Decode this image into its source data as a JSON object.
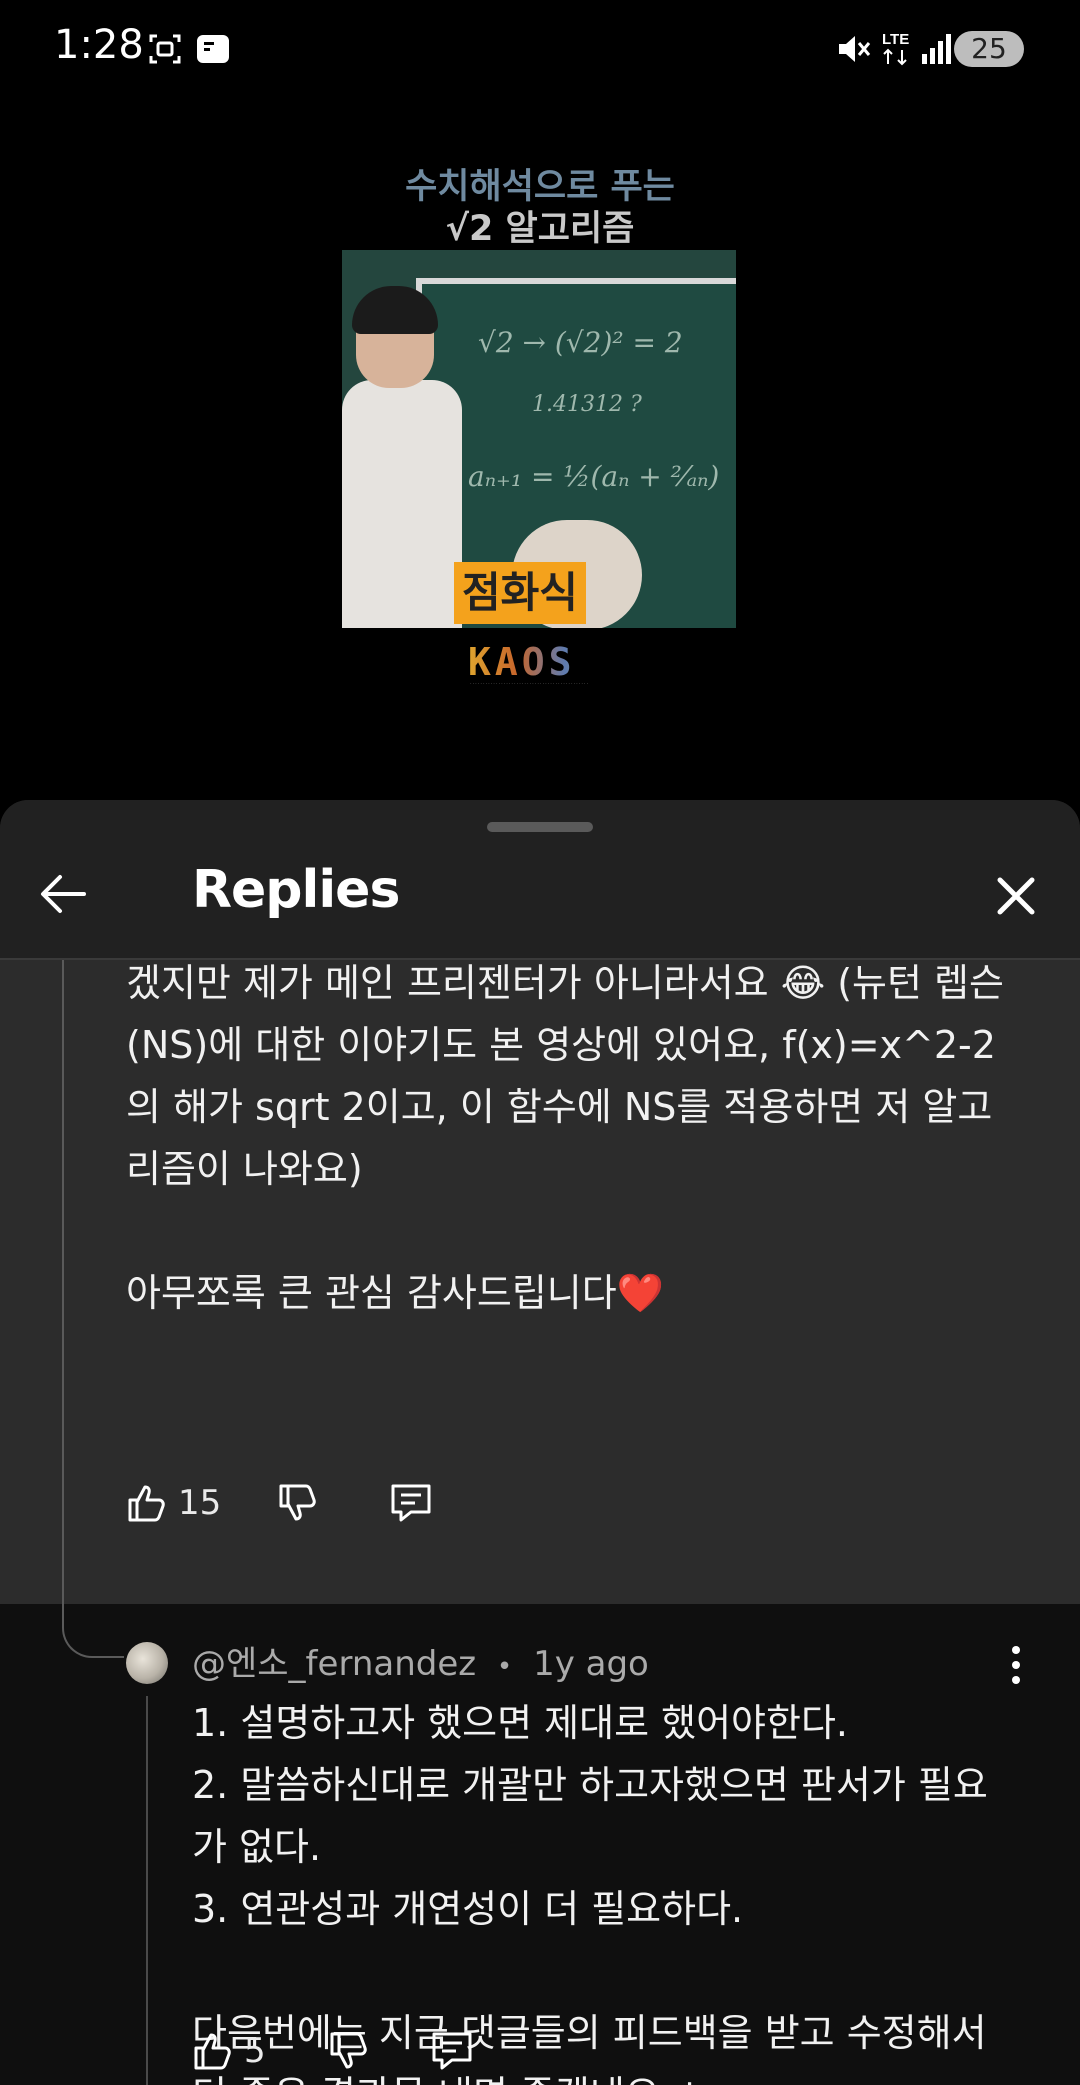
{
  "status_bar": {
    "time": "1:28",
    "network": "LTE",
    "battery": "25",
    "icons": [
      "screenshot-icon",
      "notification-icon",
      "mute-icon",
      "lte-icon",
      "signal-icon"
    ]
  },
  "video": {
    "title_line1": "수치해석으로 푸는",
    "title_line2": "√2 알고리즘",
    "subtitle": "점화식",
    "logo_text": "KAOS",
    "board_lines": [
      "√2 → (√2)² = 2",
      "1.41312 ?",
      "aₙ₊₁ = ½(aₙ + ²⁄ₐₙ)"
    ]
  },
  "sheet": {
    "title": "Replies"
  },
  "replies": [
    {
      "text": "겠지만 제가 메인 프리젠터가 아니라서요 😂 (뉴턴 렙슨(NS)에 대한 이야기도 본 영상에 있어요, f(x)=x^2-2 의 해가 sqrt 2이고, 이 함수에 NS를 적용하면 저 알고리즘이 나와요)\n\n아무쪼록 큰 관심 감사드립니다❤️",
      "likes": "15"
    },
    {
      "author": "@엔소_fernandez",
      "separator": "•",
      "time": "1y ago",
      "text": "1. 설명하고자 했으면 제대로 했어야한다.\n2. 말씀하신대로 개괄만 하고자했으면 판서가 필요가 없다.\n3. 연관성과 개연성이 더 필요하다.\n\n다음번에는 지금 댓글들의 피드백을 받고 수정해서 더 좋은 결과물 내면 좋겠네요 ㅎ",
      "likes": "5"
    }
  ],
  "colors": {
    "background": "#000000",
    "sheet": "#212121",
    "highlight_reply": "#2c2c2c",
    "meta_text": "#aaaaaa",
    "subtitle_bg": "#f4a21c"
  }
}
